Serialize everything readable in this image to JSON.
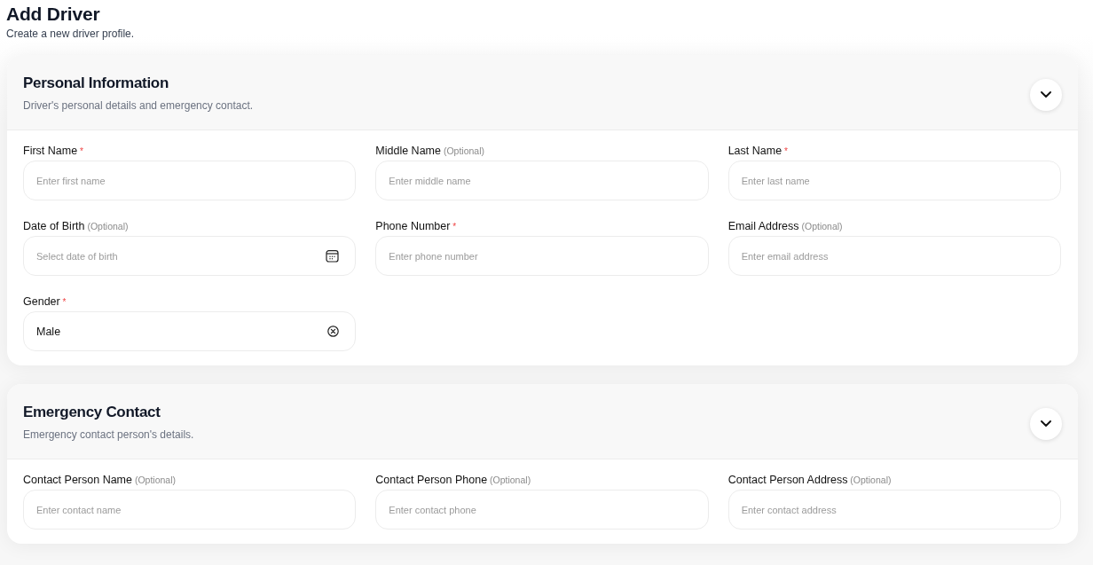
{
  "page": {
    "title": "Add Driver",
    "subtitle": "Create a new driver profile."
  },
  "sections": [
    {
      "title": "Personal Information",
      "description": "Driver's personal details and emergency contact.",
      "expanded": true,
      "fields": [
        {
          "kind": "text",
          "label": "First Name",
          "required_mark": "*",
          "placeholder": "Enter first name"
        },
        {
          "kind": "text",
          "label": "Middle Name",
          "hint": "(Optional)",
          "placeholder": "Enter middle name"
        },
        {
          "kind": "text",
          "label": "Last Name",
          "required_mark": "*",
          "placeholder": "Enter last name"
        },
        {
          "kind": "date",
          "label": "Date of Birth",
          "hint": "(Optional)",
          "placeholder": "Select date of birth"
        },
        {
          "kind": "text",
          "label": "Phone Number",
          "required_mark": "*",
          "placeholder": "Enter phone number"
        },
        {
          "kind": "text",
          "label": "Email Address",
          "hint": "(Optional)",
          "placeholder": "Enter email address"
        },
        {
          "kind": "select",
          "label": "Gender",
          "required_mark": "*",
          "value": "Male"
        }
      ]
    },
    {
      "title": "Emergency Contact",
      "description": "Emergency contact person's details.",
      "expanded": true,
      "fields": [
        {
          "kind": "text",
          "label": "Contact Person Name",
          "hint": "(Optional)",
          "placeholder": "Enter contact name"
        },
        {
          "kind": "text",
          "label": "Contact Person Phone",
          "hint": "(Optional)",
          "placeholder": "Enter contact phone"
        },
        {
          "kind": "text",
          "label": "Contact Person Address",
          "hint": "(Optional)",
          "placeholder": "Enter contact address"
        }
      ]
    }
  ]
}
